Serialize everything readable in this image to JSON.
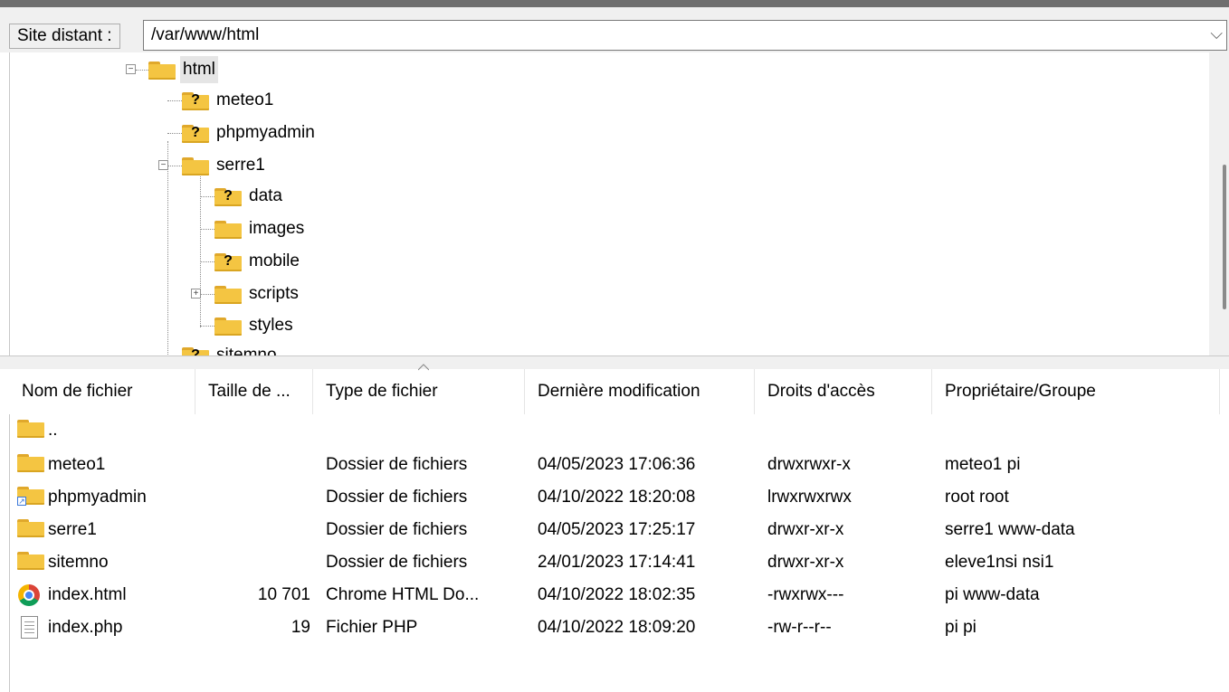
{
  "address_bar": {
    "label": "Site distant :",
    "path": "/var/www/html"
  },
  "tree": {
    "nodes": [
      {
        "label": "html",
        "icon": "folder-icon",
        "expander": "−"
      },
      {
        "label": "meteo1",
        "icon": "unknown-folder-icon"
      },
      {
        "label": "phpmyadmin",
        "icon": "unknown-folder-icon"
      },
      {
        "label": "serre1",
        "icon": "folder-icon",
        "expander": "−"
      },
      {
        "label": "data",
        "icon": "unknown-folder-icon"
      },
      {
        "label": "images",
        "icon": "folder-icon"
      },
      {
        "label": "mobile",
        "icon": "unknown-folder-icon"
      },
      {
        "label": "scripts",
        "icon": "folder-icon",
        "expander": "+"
      },
      {
        "label": "styles",
        "icon": "folder-icon"
      },
      {
        "label": "sitemno",
        "icon": "unknown-folder-icon"
      }
    ]
  },
  "list": {
    "columns": [
      "Nom de fichier",
      "Taille de ...",
      "Type de fichier",
      "Dernière modification",
      "Droits d'accès",
      "Propriétaire/Groupe"
    ],
    "rows": [
      {
        "name": "..",
        "size": "",
        "type": "",
        "modified": "",
        "perms": "",
        "owner": "",
        "icon": "folder-icon"
      },
      {
        "name": "meteo1",
        "size": "",
        "type": "Dossier de fichiers",
        "modified": "04/05/2023 17:06:36",
        "perms": "drwxrwxr-x",
        "owner": "meteo1 pi",
        "icon": "folder-icon"
      },
      {
        "name": "phpmyadmin",
        "size": "",
        "type": "Dossier de fichiers",
        "modified": "04/10/2022 18:20:08",
        "perms": "lrwxrwxrwx",
        "owner": "root root",
        "icon": "symlink-folder-icon"
      },
      {
        "name": "serre1",
        "size": "",
        "type": "Dossier de fichiers",
        "modified": "04/05/2023 17:25:17",
        "perms": "drwxr-xr-x",
        "owner": "serre1 www-data",
        "icon": "folder-icon"
      },
      {
        "name": "sitemno",
        "size": "",
        "type": "Dossier de fichiers",
        "modified": "24/01/2023 17:14:41",
        "perms": "drwxr-xr-x",
        "owner": "eleve1nsi nsi1",
        "icon": "folder-icon"
      },
      {
        "name": "index.html",
        "size": "10 701",
        "type": "Chrome HTML Do...",
        "modified": "04/10/2022 18:02:35",
        "perms": "-rwxrwx---",
        "owner": "pi www-data",
        "icon": "chrome-icon"
      },
      {
        "name": "index.php",
        "size": "19",
        "type": "Fichier PHP",
        "modified": "04/10/2022 18:09:20",
        "perms": "-rw-r--r--",
        "owner": "pi pi",
        "icon": "document-icon"
      }
    ]
  }
}
